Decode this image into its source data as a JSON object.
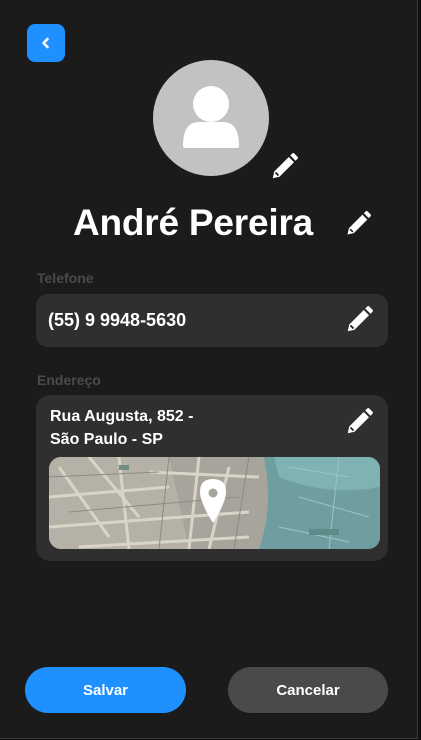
{
  "header": {
    "back_icon": "chevron-left-icon",
    "back_color": "#1e90ff"
  },
  "profile": {
    "avatar_icon": "user-silhouette-icon",
    "name": "André Pereira",
    "edit_icon": "pencil-icon"
  },
  "phone": {
    "label": "Telefone",
    "value": "(55) 9 9948-5630"
  },
  "address": {
    "label": "Endereço",
    "line1": "Rua Augusta, 852 -",
    "line2": "São Paulo - SP",
    "map_icon": "map-pin-icon"
  },
  "actions": {
    "save_label": "Salvar",
    "cancel_label": "Cancelar",
    "save_color": "#1e90ff",
    "cancel_color": "#4a4a4a"
  }
}
